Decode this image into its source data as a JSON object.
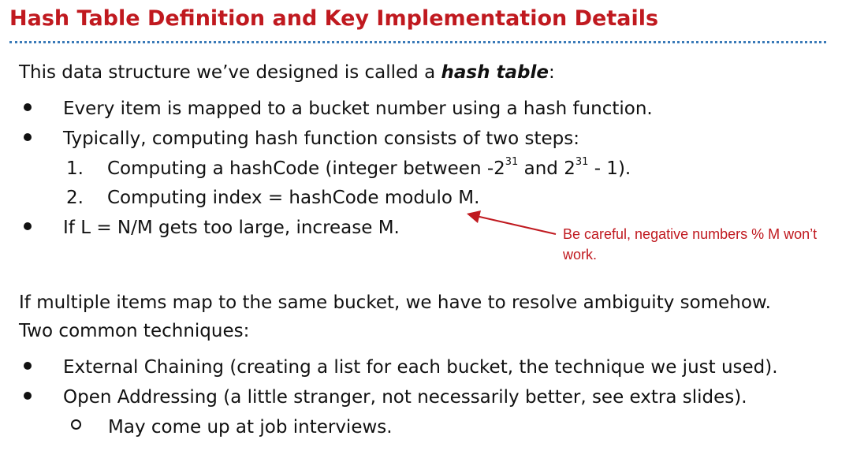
{
  "title": "Hash Table Definition and Key Implementation Details",
  "intro": {
    "before": "This data structure we’ve designed is called a ",
    "emphasis": "hash table",
    "after": ":"
  },
  "bullets_top": [
    "Every item is mapped to a bucket number using a hash function.",
    "Typically, computing hash function consists of two steps:"
  ],
  "steps": {
    "step1": {
      "number": "1.",
      "prefix": "Computing a hashCode (integer between -2",
      "exp1": "31",
      "middle": " and 2",
      "exp2": "31",
      "suffix": " - 1)."
    },
    "step2": {
      "number": "2.",
      "text": "Computing index = hashCode modulo M."
    }
  },
  "bullet_load": "If L =  N/M gets too large, increase M.",
  "callout": "Be careful, negative numbers % M won’t work.",
  "collision_para": [
    "If multiple items map to the same bucket, we have to resolve ambiguity somehow.",
    "Two common techniques:"
  ],
  "bullets_bottom": [
    "External Chaining (creating a list for each bucket, the technique we just used).",
    "Open Addressing (a little stranger, not necessarily better, see extra slides)."
  ],
  "sub_bullet": "May come up at job interviews.",
  "colors": {
    "title": "#c0191f",
    "rule": "#3a7ab8",
    "callout": "#c0191f",
    "text": "#111111"
  }
}
